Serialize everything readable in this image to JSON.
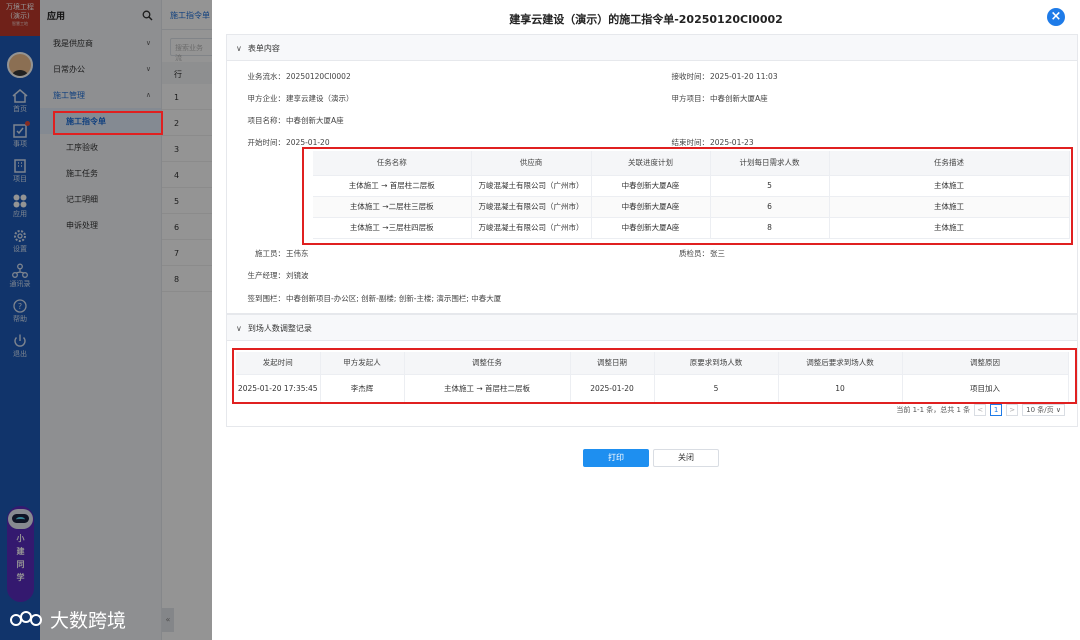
{
  "brand": {
    "line1": "万境工程",
    "line2": "(演示)",
    "line3": "智慧工地"
  },
  "rail": [
    {
      "label": "首页",
      "icon": "home-icon"
    },
    {
      "label": "事项",
      "icon": "checklist-icon"
    },
    {
      "label": "项目",
      "icon": "building-icon"
    },
    {
      "label": "应用",
      "icon": "apps-icon"
    },
    {
      "label": "设置",
      "icon": "gear-icon"
    },
    {
      "label": "通讯录",
      "icon": "contacts-icon"
    },
    {
      "label": "帮助",
      "icon": "help-icon"
    },
    {
      "label": "退出",
      "icon": "power-icon"
    }
  ],
  "assistant": {
    "label": [
      "小",
      "建",
      "同",
      "学"
    ]
  },
  "menu": {
    "title": "应用",
    "items": [
      {
        "label": "我是供应商"
      },
      {
        "label": "日常办公"
      },
      {
        "label": "施工管理"
      }
    ],
    "sub_items": [
      {
        "label": "施工指令单"
      },
      {
        "label": "工序验收"
      },
      {
        "label": "施工任务"
      },
      {
        "label": "记工明细"
      },
      {
        "label": "申诉处理"
      }
    ]
  },
  "list": {
    "tab": "施工指令单",
    "search_placeholder": "搜索业务流",
    "col": "行",
    "rows": [
      "1",
      "2",
      "3",
      "4",
      "5",
      "6",
      "7",
      "8"
    ]
  },
  "watermark": "大数跨境",
  "modal": {
    "title": "建享云建设（演示）的施工指令单-20250120CI0002",
    "close": "×",
    "section1": "表单内容",
    "section2": "到场人数调整记录",
    "fields": {
      "serial_k": "业务流水：",
      "serial_v": "20250120CI0002",
      "recv_k": "接收时间：",
      "recv_v": "2025-01-20 11:03",
      "party_k": "甲方企业：",
      "party_v": "建享云建设（演示）",
      "proj_k": "甲方项目：",
      "proj_v": "中春创新大厦A座",
      "pname_k": "项目名称：",
      "pname_v": "中春创新大厦A座",
      "start_k": "开始时间：",
      "start_v": "2025-01-20",
      "end_k": "结束时间：",
      "end_v": "2025-01-23",
      "worker_k": "施工员：",
      "worker_v": "王伟东",
      "qc_k": "质检员：",
      "qc_v": "张三",
      "pm_k": "生产经理：",
      "pm_v": "刘镜波",
      "fence_k": "签到围栏：",
      "fence_v": "中春创新项目-办公区; 创新-副楼; 创新-主楼; 演示围栏; 中春大厦"
    },
    "task_table": {
      "headers": [
        "任务名称",
        "供应商",
        "关联进度计划",
        "计划每日需求人数",
        "任务描述"
      ],
      "rows": [
        [
          "主体施工 → 首层柱二层板",
          "万峻混凝土有限公司（广州市）",
          "中春创新大厦A座",
          "5",
          "主体施工"
        ],
        [
          "主体施工 →二层柱三层板",
          "万峻混凝土有限公司（广州市）",
          "中春创新大厦A座",
          "6",
          "主体施工"
        ],
        [
          "主体施工 →三层柱四层板",
          "万峻混凝土有限公司（广州市）",
          "中春创新大厦A座",
          "8",
          "主体施工"
        ]
      ]
    },
    "adjust_table": {
      "headers": [
        "发起时间",
        "甲方发起人",
        "调整任务",
        "调整日期",
        "原要求到场人数",
        "调整后要求到场人数",
        "调整原因"
      ],
      "rows": [
        [
          "2025-01-20 17:35:45",
          "李杰辉",
          "主体施工 → 首层柱二层板",
          "2025-01-20",
          "5",
          "10",
          "项目加入"
        ]
      ]
    },
    "pager": {
      "summary": "当前 1-1 条，总共 1 条",
      "prev": "<",
      "page": "1",
      "next": ">",
      "size": "10 条/页 ∨"
    },
    "buttons": {
      "print": "打印",
      "close": "关闭"
    }
  }
}
